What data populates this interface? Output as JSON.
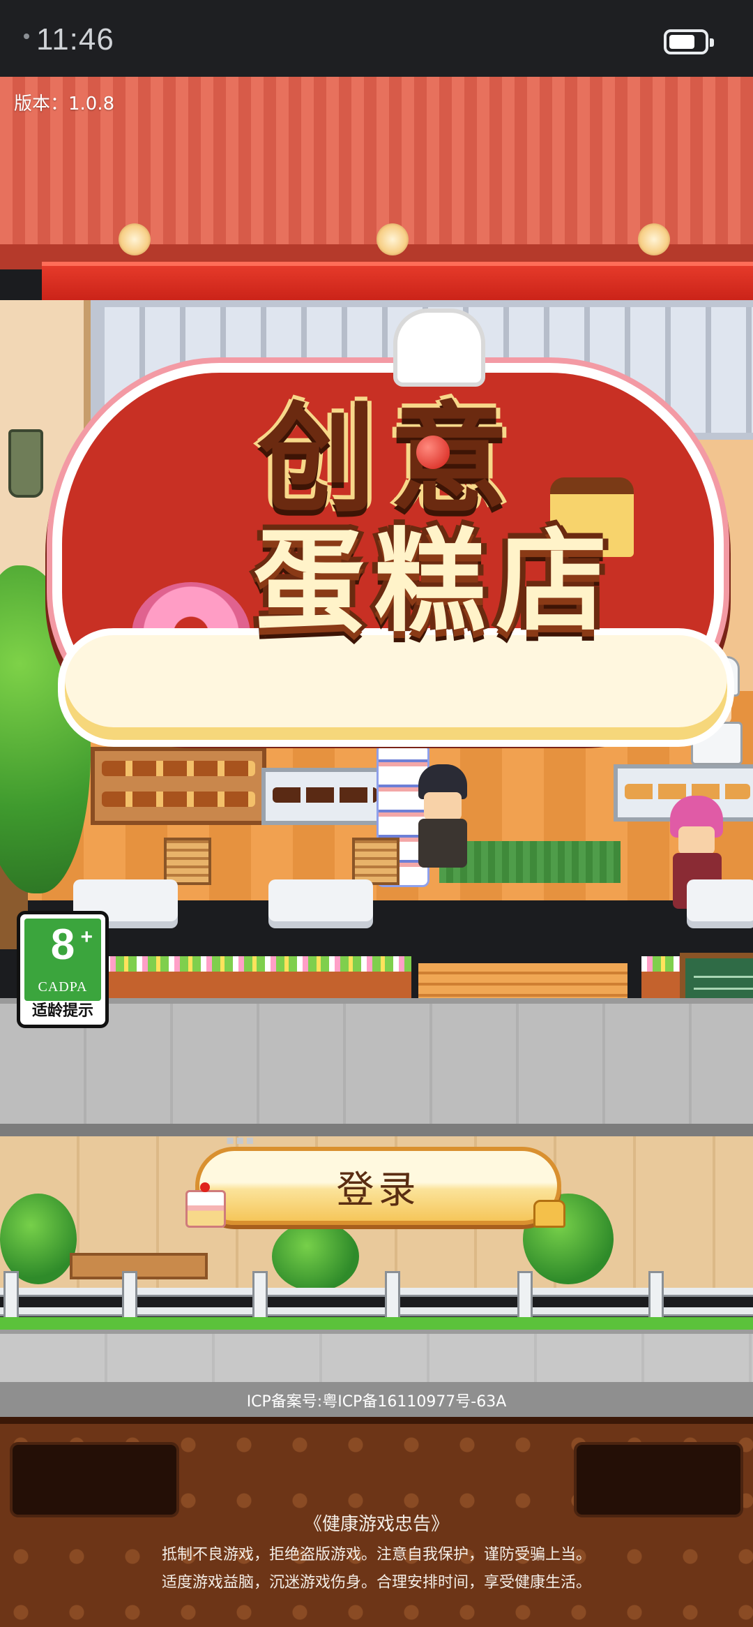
{
  "status_bar": {
    "time": "11:46"
  },
  "version_text": "版本：1.0.8",
  "logo": {
    "line1": "创意",
    "line2": "蛋糕店"
  },
  "age_rating": {
    "age": "8",
    "plus": "+",
    "org": "CADPA",
    "tip": "适龄提示"
  },
  "login_button": {
    "label": "登录"
  },
  "icp_text": "ICP备案号:粤ICP备16110977号-63A",
  "health_advice": {
    "title": "《健康游戏忠告》",
    "line1": "抵制不良游戏，拒绝盗版游戏。注意自我保护，谨防受骗上当。",
    "line2": "适度游戏益脑，沉迷游戏伤身。合理安排时间，享受健康生活。"
  },
  "colors": {
    "accent_button": "#f5c65a",
    "cadpa_green": "#3ba53d",
    "awning_red": "#c41d14"
  }
}
